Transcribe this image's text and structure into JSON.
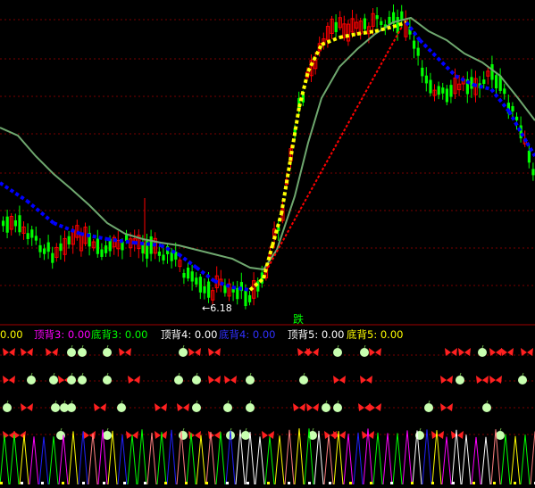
{
  "colors": {
    "background": "#000000",
    "grid": "#7a0000",
    "up_candle": "#ff0000",
    "down_candle": "#00ff00",
    "ma_slow": "#6fa86f",
    "ma_dots_down": "#0000ff",
    "ma_dots_up": "#ffff00",
    "diag_line": "#ff0000",
    "signal_text": "#00ff00",
    "low_marker": "#ffffff",
    "apple": "#c8ffb0",
    "butterfly": "#ff2020"
  },
  "main": {
    "low_marker": "←6.18",
    "signal_text": "跌"
  },
  "indicator_bar": [
    {
      "key": "zero",
      "text": "0.00",
      "color": "#ffff00"
    },
    {
      "key": "top3",
      "text": "顶背3: 0.00",
      "color": "#ff00ff"
    },
    {
      "key": "bottom3",
      "text": "底背3: 0.00",
      "color": "#00ff00"
    },
    {
      "key": "top4",
      "text": "顶背4: 0.00",
      "color": "#ffffff"
    },
    {
      "key": "bottom4",
      "text": "底背4: 0.00",
      "color": "#3030ff"
    },
    {
      "key": "top5",
      "text": "顶背5: 0.00",
      "color": "#ffffff"
    },
    {
      "key": "bottom5",
      "text": "底背5: 0.00",
      "color": "#ffff00"
    }
  ],
  "chart_data": {
    "type": "candlestick",
    "low_label_value": 6.18,
    "signal": "跌",
    "icon_rows": [
      "apple-icon",
      "butterfly-icon"
    ]
  }
}
